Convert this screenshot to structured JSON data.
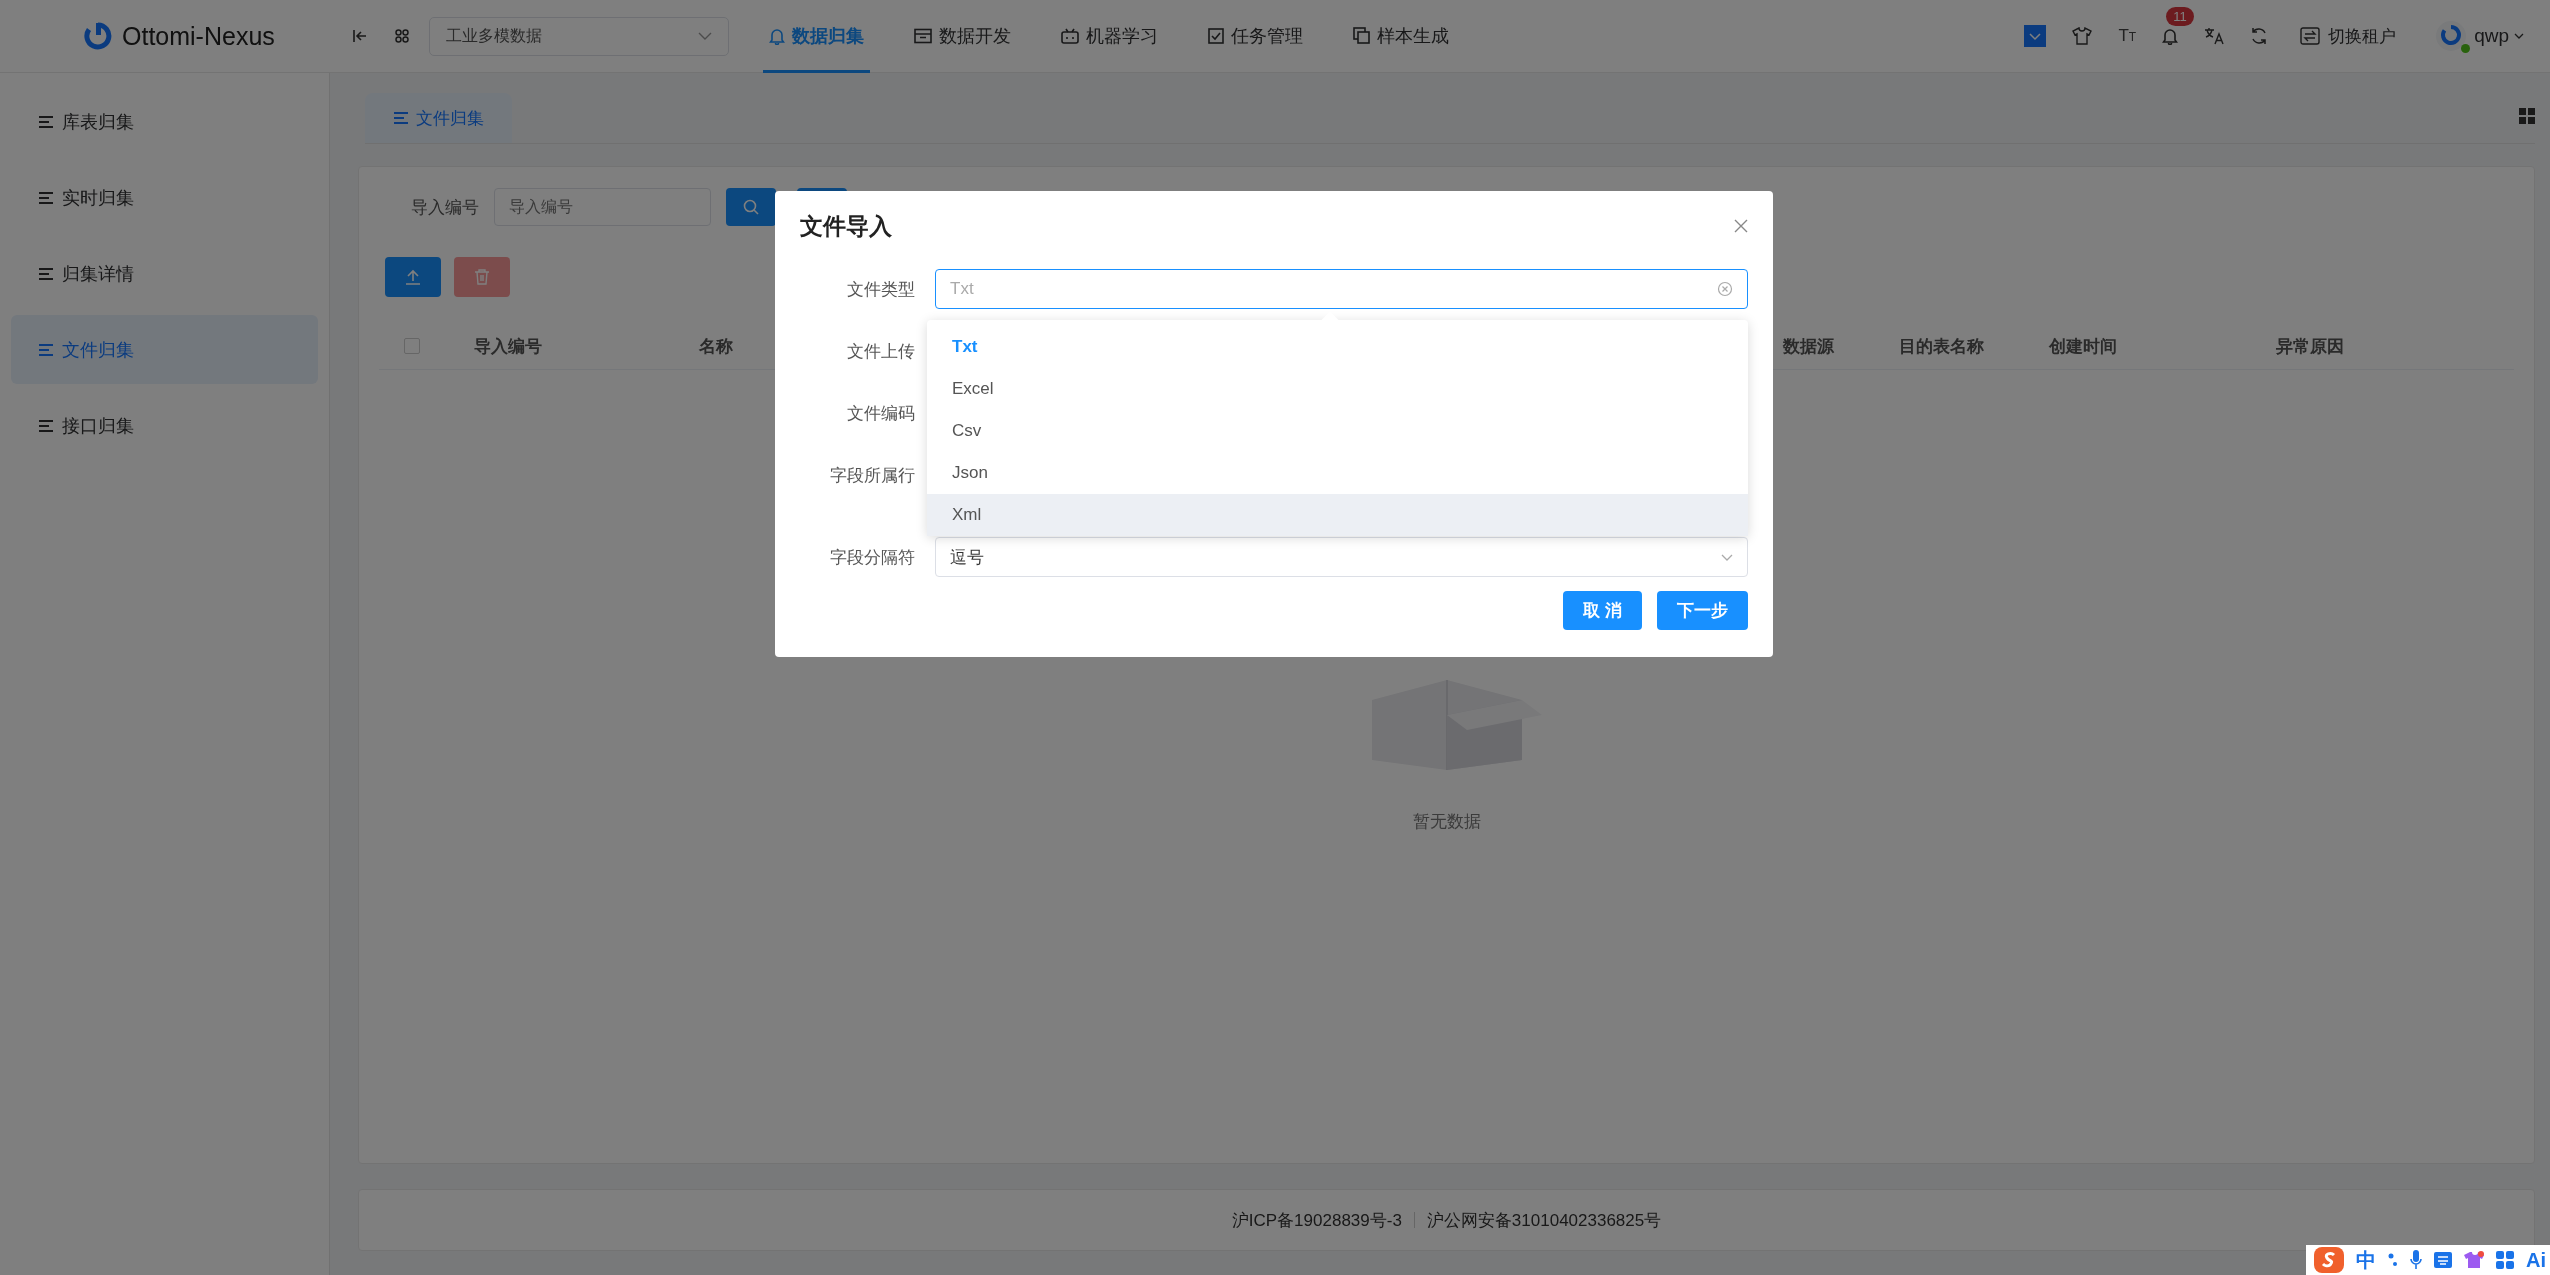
{
  "topbar": {
    "brand": "Ottomi-Nexus",
    "project_select": {
      "value": "工业多模数据"
    },
    "nav": [
      {
        "label": "数据归集",
        "selected": true
      },
      {
        "label": "数据开发",
        "selected": false
      },
      {
        "label": "机器学习",
        "selected": false
      },
      {
        "label": "任务管理",
        "selected": false
      },
      {
        "label": "样本生成",
        "selected": false
      }
    ],
    "text_size_button": "TT",
    "notification_count": "11",
    "tenant_button": "切换租户",
    "user": "qwp"
  },
  "sidebar": {
    "items": [
      {
        "label": "库表归集",
        "selected": false
      },
      {
        "label": "实时归集",
        "selected": false
      },
      {
        "label": "归集详情",
        "selected": false
      },
      {
        "label": "文件归集",
        "selected": true
      },
      {
        "label": "接口归集",
        "selected": false
      }
    ]
  },
  "tabs": [
    {
      "label": "文件归集",
      "selected": true
    }
  ],
  "search": {
    "label": "导入编号",
    "placeholder": "导入编号"
  },
  "table": {
    "select_all_checked": false,
    "columns": [
      "导入编号",
      "名称",
      "数据源",
      "目的表名称",
      "创建时间",
      "异常原因"
    ],
    "empty_text": "暂无数据"
  },
  "footer": {
    "icp": "沪ICP备19028839号-3",
    "police": "沪公网安备31010402336825号"
  },
  "dialog": {
    "title": "文件导入",
    "fields": [
      {
        "label": "文件类型",
        "kind": "select",
        "placeholder": "Txt",
        "focused": true
      },
      {
        "label": "文件上传",
        "kind": "covered"
      },
      {
        "label": "文件编码",
        "kind": "covered"
      },
      {
        "label": "字段所属行",
        "kind": "covered"
      },
      {
        "label": "字段分隔符",
        "kind": "select",
        "value": "逗号",
        "focused": false
      }
    ],
    "dropdown": {
      "options": [
        {
          "label": "Txt",
          "selected": true,
          "hovered": false
        },
        {
          "label": "Excel",
          "selected": false,
          "hovered": false
        },
        {
          "label": "Csv",
          "selected": false,
          "hovered": false
        },
        {
          "label": "Json",
          "selected": false,
          "hovered": false
        },
        {
          "label": "Xml",
          "selected": false,
          "hovered": true
        }
      ]
    },
    "buttons": [
      {
        "label": "取 消"
      },
      {
        "label": "下一步"
      }
    ]
  },
  "ime": {
    "labels": [
      "中",
      "Ai"
    ]
  }
}
